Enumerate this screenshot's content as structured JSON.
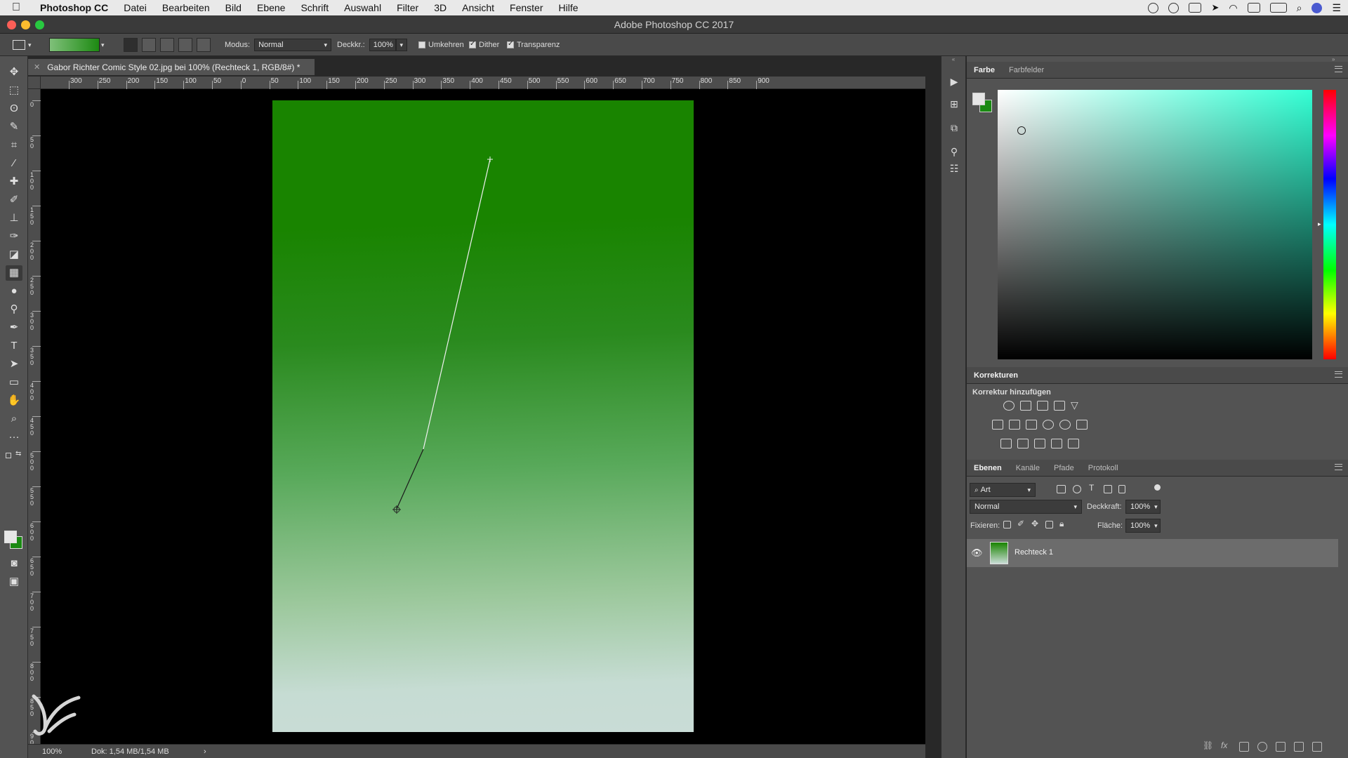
{
  "menubar": {
    "app": "Photoshop CC",
    "items": [
      "Datei",
      "Bearbeiten",
      "Bild",
      "Ebene",
      "Schrift",
      "Auswahl",
      "Filter",
      "3D",
      "Ansicht",
      "Fenster",
      "Hilfe"
    ],
    "status_icons": [
      "recording-icon",
      "creative-cloud-icon",
      "display-icon",
      "location-icon",
      "wifi-icon",
      "airplay-icon",
      "battery-icon",
      "search-icon",
      "siri-icon",
      "notification-center-icon"
    ]
  },
  "window": {
    "title": "Adobe Photoshop CC 2017"
  },
  "options": {
    "mode_label": "Modus:",
    "mode_value": "Normal",
    "opacity_label": "Deckkr.:",
    "opacity_value": "100%",
    "reverse_label": "Umkehren",
    "reverse_checked": false,
    "dither_label": "Dither",
    "dither_checked": true,
    "transparency_label": "Transparenz",
    "transparency_checked": true,
    "gradient_colors": [
      "#7fc07a",
      "#1d8a12"
    ]
  },
  "document": {
    "tab_title": "Gabor Richter Comic Style 02.jpg bei 100% (Rechteck 1, RGB/8#) *",
    "gradient_top": "#198400",
    "gradient_bottom": "#c9dcd6"
  },
  "rulers": {
    "horizontal_labels": [
      "300",
      "250",
      "200",
      "150",
      "100",
      "50",
      "0",
      "50",
      "100",
      "150",
      "200",
      "250",
      "300",
      "350",
      "400",
      "450",
      "500",
      "550",
      "600",
      "650",
      "700",
      "750",
      "800",
      "850",
      "900"
    ],
    "vertical_labels": [
      "0",
      "5 0",
      "1 0 0",
      "1 5 0",
      "2 0 0",
      "2 5 0",
      "3 0 0",
      "3 5 0",
      "4 0 0",
      "4 5 0",
      "5 0 0",
      "5 5 0",
      "6 0 0",
      "6 5 0",
      "7 0 0",
      "7 5 0",
      "8 0 0",
      "8 5 0",
      "9 0 0"
    ]
  },
  "status": {
    "zoom": "100%",
    "doc": "Dok: 1,54 MB/1,54 MB",
    "arrow": "›"
  },
  "panels": {
    "color_tabs": [
      "Farbe",
      "Farbfelder"
    ],
    "adjustments_title": "Korrekturen",
    "adjustments_subtitle": "Korrektur hinzufügen",
    "layers_tabs": [
      "Ebenen",
      "Kanäle",
      "Pfade",
      "Protokoll"
    ],
    "filter_kind": "Art",
    "blend_mode": "Normal",
    "opacity_label": "Deckkraft:",
    "opacity_value": "100%",
    "lock_label": "Fixieren:",
    "fill_label": "Fläche:",
    "fill_value": "100%",
    "layers": [
      {
        "name": "Rechteck 1",
        "visible": true
      }
    ],
    "foreground_color": "#e6e6e6",
    "background_color": "#1a8a12"
  },
  "toolbar": {
    "tools": [
      "move-icon",
      "marquee-icon",
      "lasso-icon",
      "quick-select-icon",
      "crop-icon",
      "eyedropper-icon",
      "healing-brush-icon",
      "brush-icon",
      "stamp-icon",
      "history-brush-icon",
      "eraser-icon",
      "gradient-icon",
      "blur-icon",
      "dodge-icon",
      "pen-icon",
      "type-icon",
      "path-select-icon",
      "rectangle-icon",
      "hand-icon",
      "zoom-icon",
      "more-tools-icon"
    ],
    "selected_tool": "gradient-icon"
  }
}
